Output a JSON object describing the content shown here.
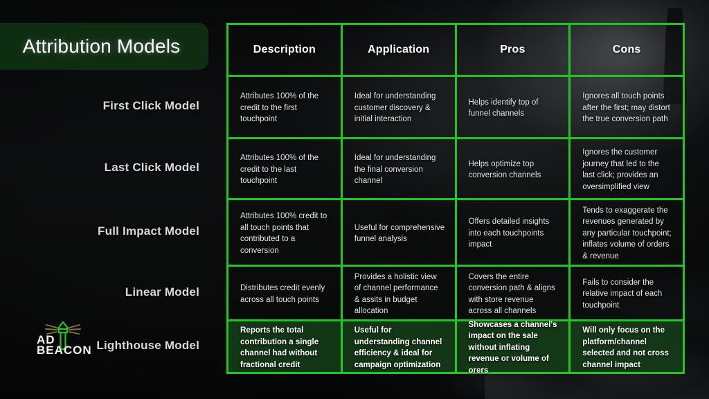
{
  "slide": {
    "title": "Attribution Models",
    "brand": {
      "logo_name": "Ad Beacon",
      "line1": "AD",
      "line2": "BEACON"
    },
    "colors": {
      "accent_green": "#22c522",
      "title_badge_bg": "#0f2e11",
      "highlight_row_bg": "#143e18",
      "background": "#0a0b0c",
      "text": "#e6e8e8"
    }
  },
  "table": {
    "column_headers": [
      "Description",
      "Application",
      "Pros",
      "Cons"
    ],
    "rows": [
      {
        "label": "First Click Model",
        "highlight": false,
        "cells": [
          "Attributes 100% of the credit to the first touchpoint",
          "Ideal for understanding customer discovery & initial interaction",
          "Helps identify top of funnel channels",
          "Ignores all touch points after the first; may distort the true conversion path"
        ]
      },
      {
        "label": "Last Click Model",
        "highlight": false,
        "cells": [
          "Attributes 100% of the credit to the last touchpoint",
          "Ideal for understanding the final conversion channel",
          "Helps optimize top conversion channels",
          "Ignores the customer journey that led to the last click; provides an oversimplified view"
        ]
      },
      {
        "label": "Full Impact Model",
        "highlight": false,
        "cells": [
          "Attributes 100% credit to all touch points that contributed to a conversion",
          "Useful for comprehensive funnel analysis",
          "Offers detailed insights into each touchpoints impact",
          "Tends to exaggerate the revenues generated by any particular touchpoint; inflates volume of orders & revenue"
        ]
      },
      {
        "label": "Linear Model",
        "highlight": false,
        "cells": [
          "Distributes credit evenly across all touch points",
          "Provides a holistic view of channel performance & assits in budget allocation",
          "Covers the entire conversion path & aligns with store revenue across all channels",
          "Fails to consider the relative impact of each touchpoint"
        ]
      },
      {
        "label": "Lighthouse Model",
        "highlight": true,
        "cells": [
          "Reports the total contribution a single channel had without fractional credit",
          "Useful for understanding channel efficiency & ideal for campaign optimization",
          "Showcases a channel's impact on the sale without inflating revenue or volume of orers",
          "Will only focus on the platform/channel selected and not cross channel impact"
        ]
      }
    ]
  }
}
